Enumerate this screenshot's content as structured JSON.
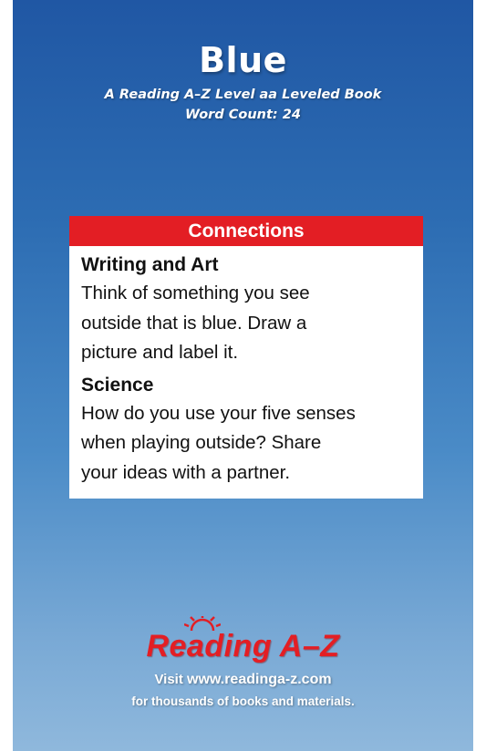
{
  "cover": {
    "title": "Blue",
    "subtitle": "A Reading A–Z Level aa Leveled Book",
    "word_count": "Word Count: 24"
  },
  "connections": {
    "header": "Connections",
    "sections": [
      {
        "heading": "Writing and Art",
        "lines": [
          "Think of something you see",
          "outside that is blue. Draw a",
          "picture and label it."
        ]
      },
      {
        "heading": "Science",
        "lines": [
          "How do you use your five senses",
          "when playing outside? Share",
          "your ideas with a partner."
        ]
      }
    ]
  },
  "footer": {
    "logo_text": "Reading A–Z",
    "visit_prefix": "Visit",
    "url": "www.readinga-z.com",
    "tagline": "for thousands of books and materials."
  },
  "colors": {
    "accent_red": "#e31e24",
    "sky_top": "#2057a4",
    "sky_bottom": "#8fb8dc"
  }
}
